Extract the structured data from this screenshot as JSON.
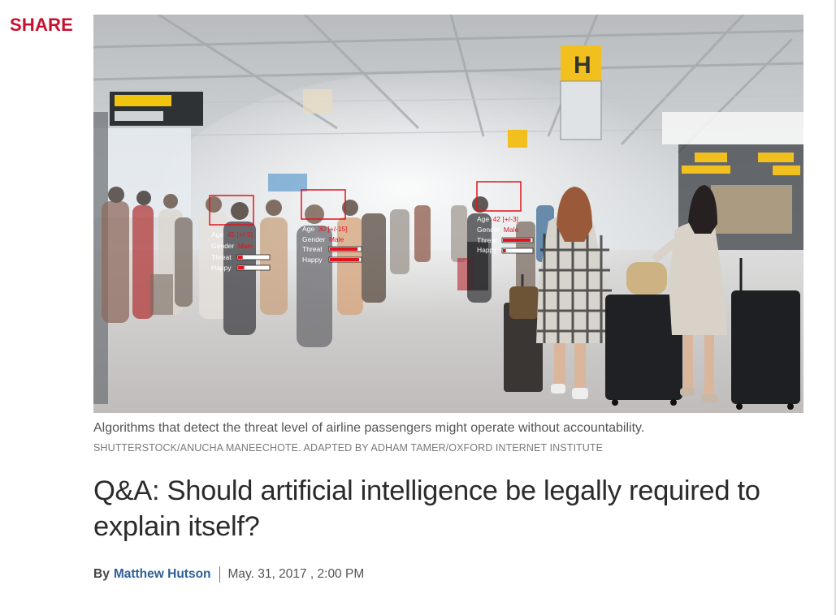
{
  "share": {
    "label": "SHARE"
  },
  "hero": {
    "overlays": [
      {
        "age_label": "Age",
        "age_value": "45 [+/-3]",
        "gender_label": "Gender",
        "gender_value": "Male",
        "threat_label": "Threat",
        "happy_label": "Happy",
        "threat_level": 0.15,
        "happy_level": 0.2
      },
      {
        "age_label": "Age",
        "age_value": "30 [+/-15]",
        "gender_label": "Gender",
        "gender_value": "Male",
        "threat_label": "Threat",
        "happy_label": "Happy",
        "threat_level": 0.9,
        "happy_level": 0.95
      },
      {
        "age_label": "Age",
        "age_value": "42 [+/-3]",
        "gender_label": "Gender",
        "gender_value": "Male",
        "threat_label": "Threat",
        "happy_label": "Happy",
        "threat_level": 0.95,
        "happy_level": 0.1
      }
    ]
  },
  "caption": "Algorithms that detect the threat level of airline passengers might operate without accountability.",
  "credit": "SHUTTERSTOCK/ANUCHA MANEECHOTE. ADAPTED BY ADHAM TAMER/OXFORD INTERNET INSTITUTE",
  "article": {
    "title": "Q&A: Should artificial intelligence be legally required to explain itself?",
    "by_label": "By",
    "author": "Matthew Hutson",
    "date": "May. 31, 2017 , 2:00 PM"
  },
  "colors": {
    "brand_red": "#c8102e",
    "author_blue": "#2f5f9a",
    "overlay_red": "#e0141c"
  }
}
